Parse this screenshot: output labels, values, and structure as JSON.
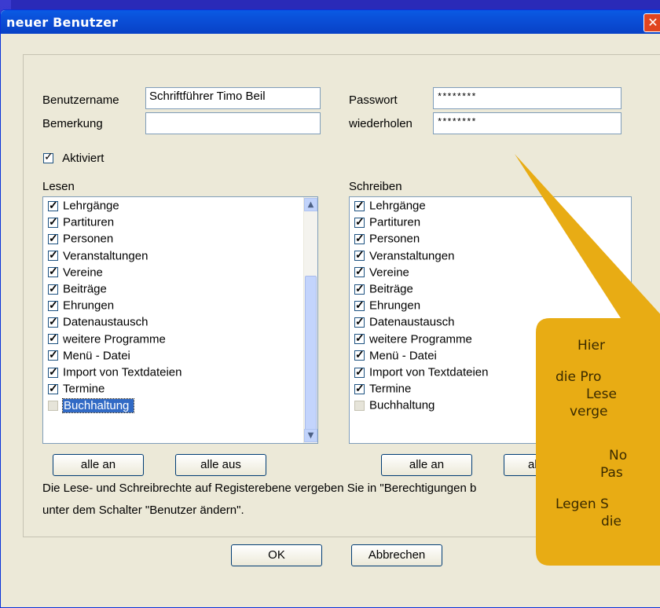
{
  "window": {
    "title": "neuer Benutzer",
    "close_glyph": "✕"
  },
  "form": {
    "username_label": "Benutzername",
    "username_value": "Schriftführer Timo Beil",
    "comment_label": "Bemerkung",
    "comment_value": "",
    "password_label": "Passwort",
    "password_value": "********",
    "repeat_label": "wiederholen",
    "repeat_value": "********",
    "activated_label": "Aktiviert",
    "activated_checked": true
  },
  "read": {
    "label": "Lesen",
    "items": [
      {
        "label": "Lehrgänge",
        "checked": true
      },
      {
        "label": "Partituren",
        "checked": true
      },
      {
        "label": "Personen",
        "checked": true
      },
      {
        "label": "Veranstaltungen",
        "checked": true
      },
      {
        "label": "Vereine",
        "checked": true
      },
      {
        "label": "Beiträge",
        "checked": true
      },
      {
        "label": "Ehrungen",
        "checked": true
      },
      {
        "label": "Datenaustausch",
        "checked": true
      },
      {
        "label": "weitere Programme",
        "checked": true
      },
      {
        "label": "Menü - Datei",
        "checked": true
      },
      {
        "label": "Import von Textdateien",
        "checked": true
      },
      {
        "label": "Termine",
        "checked": true
      },
      {
        "label": "Buchhaltung",
        "checked": false,
        "selected": true
      }
    ],
    "all_on": "alle an",
    "all_off": "alle aus"
  },
  "write": {
    "label": "Schreiben",
    "items": [
      {
        "label": "Lehrgänge",
        "checked": true
      },
      {
        "label": "Partituren",
        "checked": true
      },
      {
        "label": "Personen",
        "checked": true
      },
      {
        "label": "Veranstaltungen",
        "checked": true
      },
      {
        "label": "Vereine",
        "checked": true
      },
      {
        "label": "Beiträge",
        "checked": true
      },
      {
        "label": "Ehrungen",
        "checked": true
      },
      {
        "label": "Datenaustausch",
        "checked": true
      },
      {
        "label": "weitere Programme",
        "checked": true
      },
      {
        "label": "Menü - Datei",
        "checked": true
      },
      {
        "label": "Import von Textdateien",
        "checked": true
      },
      {
        "label": "Termine",
        "checked": true
      },
      {
        "label": "Buchhaltung",
        "checked": false
      }
    ],
    "all_on": "alle an",
    "all_off": "alle"
  },
  "info": {
    "line1": "Die Lese- und Schreibrechte auf Registerebene vergeben Sie in \"Berechtigungen b",
    "line2": "unter dem Schalter \"Benutzer ändern\"."
  },
  "buttons": {
    "ok": "OK",
    "cancel": "Abbrechen"
  },
  "callout": {
    "lines": [
      "Hier",
      "die Pro",
      "Lese",
      "verge",
      "No",
      "Pas",
      "Legen S",
      "die"
    ],
    "color": "#e8ac14"
  }
}
